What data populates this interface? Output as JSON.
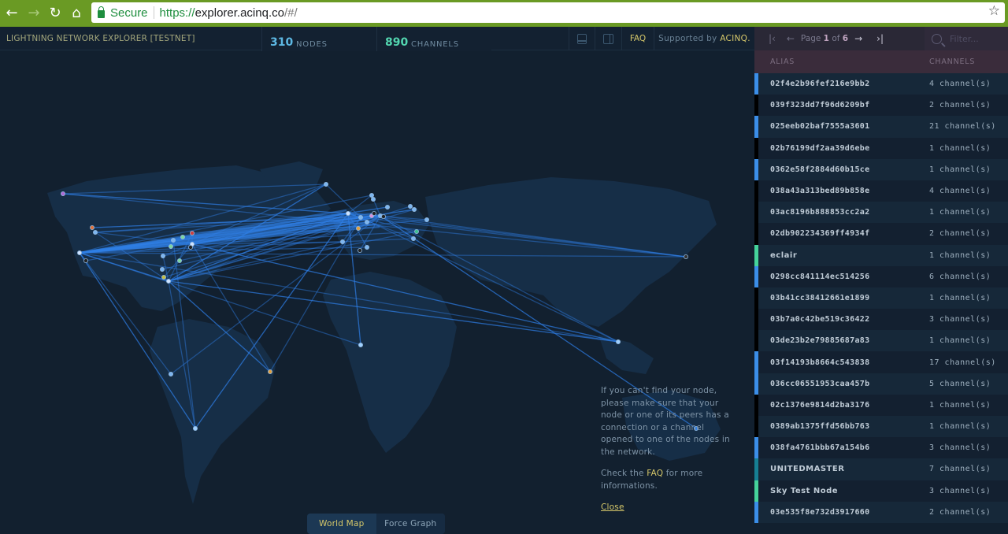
{
  "browser": {
    "back_icon": "arrow-left-icon",
    "forward_icon": "arrow-right-icon",
    "reload_icon": "reload-icon",
    "home_icon": "home-icon",
    "secure_label": "Secure",
    "url_scheme": "https://",
    "url_host": "explorer.acinq.co",
    "url_path": "/#/",
    "bookmark_icon": "star-icon"
  },
  "header": {
    "title": "LIGHTNING NETWORK EXPLORER [TESTNET]",
    "nodes_count": "310",
    "nodes_label": "NODES",
    "channels_count": "890",
    "channels_label": "CHANNELS",
    "layout_bottom_icon": "panel-bottom-icon",
    "layout_side_icon": "panel-side-icon",
    "faq_label": "FAQ",
    "supported_prefix": "Supported by",
    "supported_brand": "ACINQ."
  },
  "colors": {
    "nodes_accent": "#5db8e3",
    "channels_accent": "#53d6b0",
    "link_yellow": "#d6c86a",
    "channel_line": "#2f7fe6",
    "strip_blue": "#3b8ee8",
    "strip_green": "#45d39a",
    "strip_teal": "#167f93",
    "strip_black": "#000000"
  },
  "pager": {
    "first_icon": "first-page-icon",
    "prev_icon": "prev-page-icon",
    "page_prefix": "Page",
    "current_page": "1",
    "of_label": "of",
    "total_pages": "6",
    "next_icon": "next-page-icon",
    "last_icon": "last-page-icon"
  },
  "filter": {
    "placeholder": "Filter..."
  },
  "table": {
    "headers": {
      "alias": "ALIAS",
      "channels": "CHANNELS"
    },
    "rows": [
      {
        "alias": "02f4e2b96fef216e9bb2",
        "channels": "4 channel(s)",
        "color": "blue"
      },
      {
        "alias": "039f323dd7f96d6209bf",
        "channels": "2 channel(s)",
        "color": "black"
      },
      {
        "alias": "025eeb02baf7555a3601",
        "channels": "21 channel(s)",
        "color": "blue"
      },
      {
        "alias": "02b76199df2aa39d6ebe",
        "channels": "1 channel(s)",
        "color": "black"
      },
      {
        "alias": "0362e58f2884d60b15ce",
        "channels": "1 channel(s)",
        "color": "blue"
      },
      {
        "alias": "038a43a313bed89b858e",
        "channels": "4 channel(s)",
        "color": "black"
      },
      {
        "alias": "03ac8196b888853cc2a2",
        "channels": "1 channel(s)",
        "color": "black"
      },
      {
        "alias": "02db902234369ff4934f",
        "channels": "2 channel(s)",
        "color": "black"
      },
      {
        "alias": "eclair",
        "channels": "1 channel(s)",
        "color": "green",
        "named": true
      },
      {
        "alias": "0298cc841114ec514256",
        "channels": "6 channel(s)",
        "color": "blue"
      },
      {
        "alias": "03b41cc38412661e1899",
        "channels": "1 channel(s)",
        "color": "black"
      },
      {
        "alias": "03b7a0c42be519c36422",
        "channels": "3 channel(s)",
        "color": "black"
      },
      {
        "alias": "03de23b2e79885687a83",
        "channels": "1 channel(s)",
        "color": "black"
      },
      {
        "alias": "03f14193b8664c543838",
        "channels": "17 channel(s)",
        "color": "blue"
      },
      {
        "alias": "036cc06551953caa457b",
        "channels": "5 channel(s)",
        "color": "blue"
      },
      {
        "alias": "02c1376e9814d2ba3176",
        "channels": "1 channel(s)",
        "color": "black"
      },
      {
        "alias": "0389ab1375ffd56bb763",
        "channels": "1 channel(s)",
        "color": "black"
      },
      {
        "alias": "038fa4761bbb67a154b6",
        "channels": "3 channel(s)",
        "color": "blue"
      },
      {
        "alias": "UNITEDMASTER",
        "channels": "7 channel(s)",
        "color": "teal",
        "named": true
      },
      {
        "alias": "Sky Test Node",
        "channels": "3 channel(s)",
        "color": "green",
        "named": true
      },
      {
        "alias": "03e535f8e732d3917660",
        "channels": "2 channel(s)",
        "color": "blue"
      }
    ]
  },
  "infobox": {
    "message": "If you can't find your node, please make sure that your node or one of its peers has a connection or a channel opened to one of the nodes in the network.",
    "check_prefix": "Check the",
    "faq_link": "FAQ",
    "check_suffix": "for more informations.",
    "close_label": "Close"
  },
  "view_toggle": {
    "options": [
      {
        "label": "World Map",
        "active": true
      },
      {
        "label": "Force Graph",
        "active": false
      }
    ]
  }
}
